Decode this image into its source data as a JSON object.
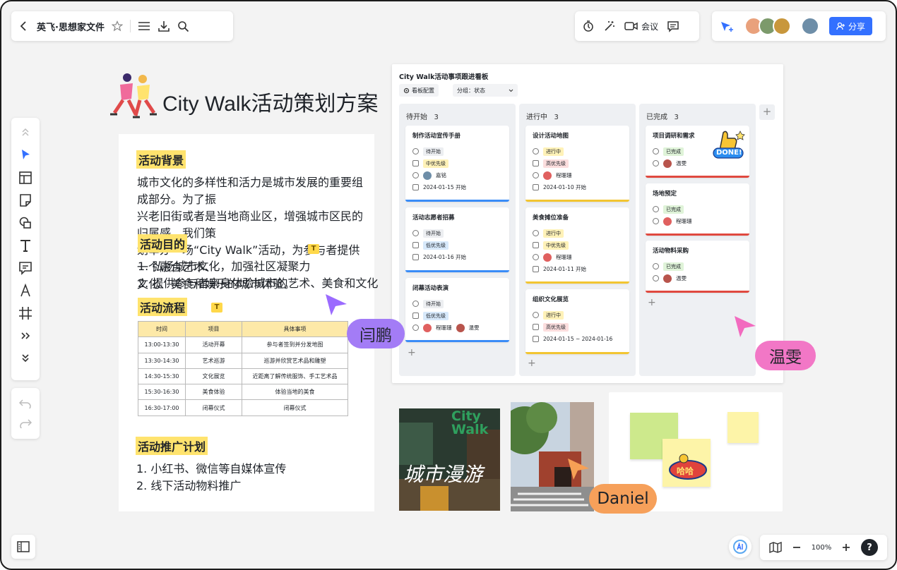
{
  "topbar": {
    "title": "英飞·思想家文件",
    "meeting_label": "会议",
    "share_label": "分享"
  },
  "doc": {
    "header_title": "City Walk活动策划方案",
    "sec1_title": "活动背景",
    "sec1_l1": "城市文化的多样性和活力是城市发展的重要组成部分。为了振",
    "sec1_l2": "兴老旧街或者是当地商业区，增强城市区民的归属感，我们策",
    "sec1_l3": "划举办一场“City Walk”活动，为参与者提供一个融合艺术、",
    "sec1_l4": "文化、美食和娱乐的城市体验。",
    "sec2_title": "活动目的",
    "sec2_i1": "1. 弘扬城市文化，加强社区凝聚力",
    "sec2_i2": "2. 提供参与者亲身体验城市的艺术、美食和文化",
    "sec3_title": "活动流程",
    "table_head": [
      "时间",
      "项目",
      "具体事项"
    ],
    "table_rows": [
      [
        "13:00-13:30",
        "活动开幕",
        "参与者签到并分发地图"
      ],
      [
        "13:30-14:30",
        "艺术巡游",
        "巡游并欣赏艺术品和雕塑"
      ],
      [
        "14:30-15:30",
        "文化展览",
        "近距离了解传统服饰、手工艺术品"
      ],
      [
        "15:30-16:30",
        "美食体验",
        "体验当地的美食"
      ],
      [
        "16:30-17:00",
        "闭幕仪式",
        "闭幕仪式"
      ]
    ],
    "sec4_title": "活动推广计划",
    "sec4_i1": "1. 小红书、微信等自媒体宣传",
    "sec4_i2": "2. 线下活动物料推广"
  },
  "board": {
    "title": "City Walk活动事项跟进看板",
    "config_label": "看板配置",
    "group_label": "分组：状态",
    "columns": [
      {
        "name": "待开始",
        "count": "3",
        "cards": [
          {
            "title": "制作活动宣传手册",
            "status": "待开始",
            "priority": "中优先级",
            "person": "嘉铭",
            "date": "2024-01-15 开始"
          },
          {
            "title": "活动志愿者招募",
            "status": "待开始",
            "priority": "低优先级",
            "date": "2024-01-16 开始"
          },
          {
            "title": "闭幕活动表演",
            "status": "待开始",
            "priority": "低优先级",
            "person": "程珊珊",
            "person2": "温雯"
          }
        ]
      },
      {
        "name": "进行中",
        "count": "3",
        "cards": [
          {
            "title": "设计活动地图",
            "status": "进行中",
            "priority": "高优先级",
            "person": "程珊珊",
            "date": "2024-01-10 开始"
          },
          {
            "title": "美食摊位准备",
            "status": "进行中",
            "priority": "中优先级",
            "person": "程珊珊",
            "date": "2024-01-11 开始"
          },
          {
            "title": "组织文化展览",
            "status": "进行中",
            "priority": "高优先级",
            "date": "2024-01-15 ~ 2024-01-16"
          }
        ]
      },
      {
        "name": "已完成",
        "count": "3",
        "cards": [
          {
            "title": "项目调研和需求",
            "status": "已完成",
            "person": "温雯"
          },
          {
            "title": "场地预定",
            "status": "已完成",
            "person": "程珊珊"
          },
          {
            "title": "活动物料采购",
            "status": "已完成",
            "person": "温雯"
          }
        ]
      }
    ]
  },
  "stickers": {
    "done": "DONE!",
    "poster_en": "City Walk",
    "poster_cn": "城市漫游",
    "yay": "哈哈"
  },
  "cursors": {
    "c1": "闫鹏",
    "c2": "温雯",
    "c3": "Daniel"
  },
  "zoom": {
    "level": "100%",
    "help": "?"
  },
  "colors": {
    "accent": "#3370ff",
    "highlight": "#ffe36e",
    "purple_cursor": "#9b6bff",
    "pink_cursor": "#f26bbf",
    "orange_cursor": "#f7a055"
  }
}
